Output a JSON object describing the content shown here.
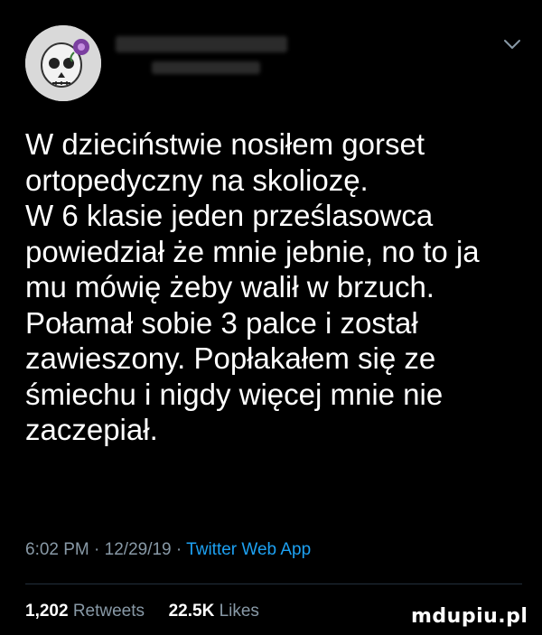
{
  "tweet": {
    "text": "W dzieciństwie nosiłem gorset\nortopedyczny na skoliozę.\nW 6 klasie jeden prześlasowca\npowiedział że mnie jebnie, no to ja\nmu mówię żeby walił w brzuch.\nPołamał sobie 3 palce i został\nzawieszony. Popłakałem się ze\nśmiechu i nigdy więcej mnie nie\nzaczepiał.",
    "time": "6:02 PM",
    "separator": "·",
    "date": "12/29/19",
    "source": "Twitter Web App"
  },
  "stats": {
    "retweets_count": "1,202",
    "retweets_label": "Retweets",
    "likes_count": "22.5K",
    "likes_label": "Likes"
  },
  "watermark": "mdupiu.pl",
  "icons": {
    "avatar": "skull-avatar",
    "menu": "chevron-down-icon"
  },
  "colors": {
    "background": "#000000",
    "text": "#ffffff",
    "muted": "#8899a6",
    "link": "#1da1f2"
  }
}
